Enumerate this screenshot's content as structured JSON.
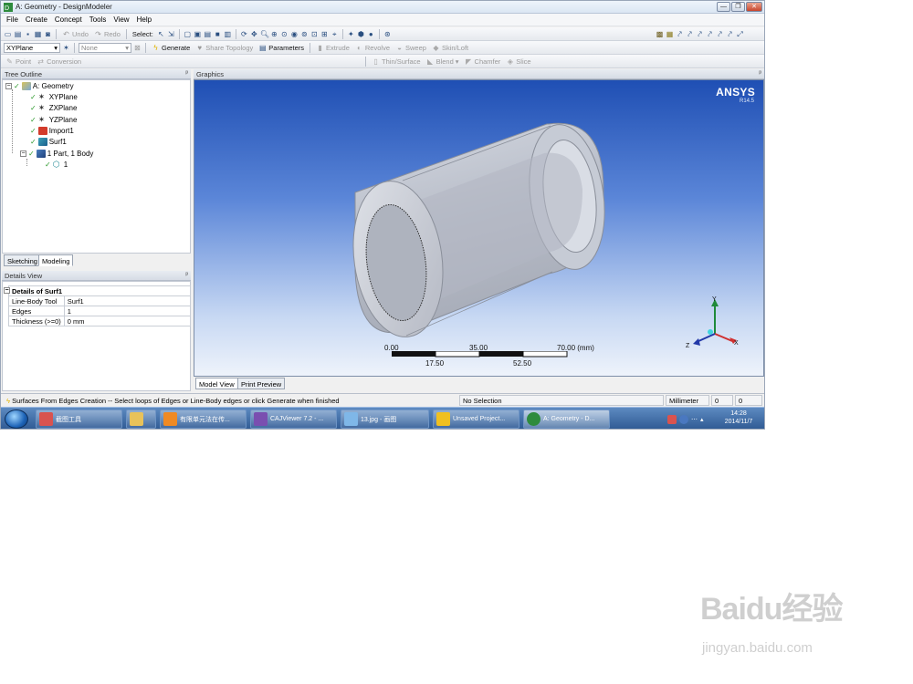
{
  "window": {
    "title": "A: Geometry - DesignModeler",
    "buttons": {
      "minimize": "—",
      "maximize": "❐",
      "close": "✕"
    }
  },
  "menu": [
    "File",
    "Create",
    "Concept",
    "Tools",
    "View",
    "Help"
  ],
  "toolbar1": {
    "undo": "Undo",
    "redo": "Redo",
    "select_label": "Select:"
  },
  "toolbar2": {
    "plane_value": "XYPlane",
    "sketch_value": "None",
    "generate": "Generate",
    "share_topology": "Share Topology",
    "parameters": "Parameters",
    "extrude": "Extrude",
    "revolve": "Revolve",
    "sweep": "Sweep",
    "skinloft": "Skin/Loft"
  },
  "toolbar3": {
    "point": "Point",
    "conversion": "Conversion",
    "thin_surface": "Thin/Surface",
    "blend": "Blend",
    "chamfer": "Chamfer",
    "slice": "Slice"
  },
  "tree": {
    "header": "Tree Outline",
    "pin": "ᵖ",
    "nodes": [
      {
        "label": "A: Geometry",
        "icon": "geometry-icon"
      },
      {
        "label": "XYPlane",
        "icon": "plane-icon"
      },
      {
        "label": "ZXPlane",
        "icon": "plane-icon"
      },
      {
        "label": "YZPlane",
        "icon": "plane-icon"
      },
      {
        "label": "Import1",
        "icon": "import-icon"
      },
      {
        "label": "Surf1",
        "icon": "surface-icon"
      },
      {
        "label": "1 Part, 1 Body",
        "icon": "part-icon"
      },
      {
        "label": "1",
        "icon": "body-icon"
      }
    ],
    "tabs": [
      "Sketching",
      "Modeling"
    ]
  },
  "details": {
    "header": "Details View",
    "title": "Details of Surf1",
    "rows": [
      {
        "key": "Line-Body Tool",
        "value": "Surf1"
      },
      {
        "key": "Edges",
        "value": "1"
      },
      {
        "key": "Thickness (>=0)",
        "value": "0 mm"
      }
    ]
  },
  "graphics": {
    "header": "Graphics",
    "logo": "ANSYS",
    "version": "R14.5",
    "scale_top": [
      "0.00",
      "35.00",
      "70.00 (mm)"
    ],
    "scale_bottom": [
      "17.50",
      "52.50"
    ],
    "axes": {
      "y": "Y",
      "x": "X",
      "z": "Z"
    },
    "tabs": [
      "Model View",
      "Print Preview"
    ],
    "colors": {
      "axis_x": "#d03030",
      "axis_y": "#1f8a3a",
      "axis_z": "#2238a8"
    }
  },
  "status": {
    "message": "Surfaces From Edges Creation -- Select loops of Edges or Line-Body edges or click Generate when finished",
    "selection": "No Selection",
    "units": "Millimeter",
    "v1": "0",
    "v2": "0"
  },
  "taskbar": {
    "items": [
      "截图工具",
      "",
      "有限单元法在传...",
      "CAJViewer 7.2 - ...",
      "13.jpg - 画图",
      "Unsaved Project...",
      "A: Geometry - D..."
    ],
    "time": "14:28",
    "date": "2014/11/7"
  },
  "watermark": {
    "brand": "Baidu经验",
    "url": "jingyan.baidu.com"
  }
}
